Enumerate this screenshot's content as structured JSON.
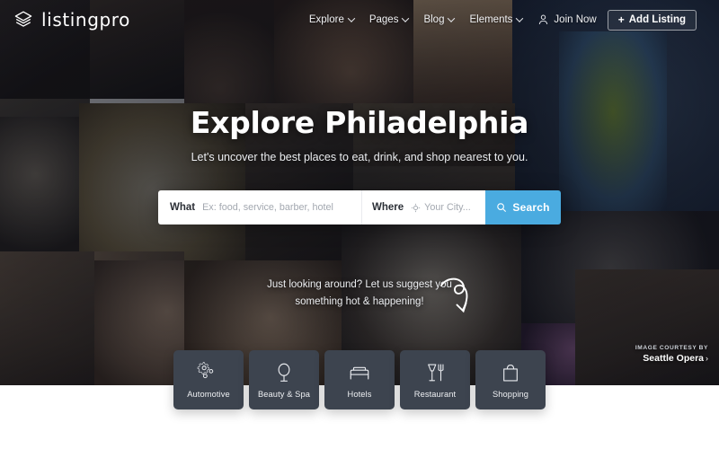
{
  "brand": {
    "name": "listingpro",
    "logo_icon": "layers-stack-icon"
  },
  "nav": {
    "items": [
      {
        "label": "Explore",
        "icon": "chevron-down-icon"
      },
      {
        "label": "Pages",
        "icon": "chevron-down-icon"
      },
      {
        "label": "Blog",
        "icon": "chevron-down-icon"
      },
      {
        "label": "Elements",
        "icon": "chevron-down-icon"
      }
    ],
    "join": {
      "label": "Join Now",
      "icon": "user-icon"
    },
    "add_listing": {
      "label": "Add Listing",
      "icon": "plus-icon",
      "plus": "+"
    }
  },
  "hero": {
    "title": "Explore Philadelphia",
    "subtitle": "Let's uncover the best places to eat, drink, and shop nearest to you."
  },
  "search": {
    "what_label": "What",
    "what_placeholder": "Ex: food, service, barber, hotel",
    "what_value": "",
    "where_label": "Where",
    "where_placeholder": "Your City...",
    "where_value": "",
    "where_icon": "crosshair-locate-icon",
    "button_label": "Search",
    "button_icon": "search-icon",
    "button_color": "#4aabe0"
  },
  "suggest": {
    "line1": "Just looking around? Let us suggest you",
    "line2": "something hot & happening!",
    "arrow_icon": "curly-arrow-down-icon"
  },
  "courtesy": {
    "prefix": "IMAGE COURTESY BY",
    "name": "Seattle Opera",
    "chevron": "›"
  },
  "categories": [
    {
      "label": "Automotive",
      "icon": "gears-icon"
    },
    {
      "label": "Beauty & Spa",
      "icon": "mirror-icon"
    },
    {
      "label": "Hotels",
      "icon": "bed-icon"
    },
    {
      "label": "Restaurant",
      "icon": "fork-and-glass-icon"
    },
    {
      "label": "Shopping",
      "icon": "shopping-bag-icon"
    }
  ],
  "theme": {
    "card_bg": "#3d444f",
    "accent": "#4aabe0",
    "overlay": "rgba(18,20,28,0.52)"
  }
}
